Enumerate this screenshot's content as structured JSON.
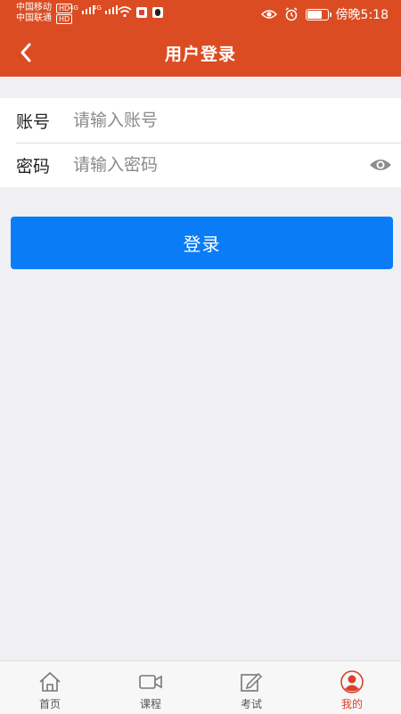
{
  "status_bar": {
    "carrier1": "中国移动",
    "carrier2": "中国联通",
    "hd_badge": "HD",
    "net1": "4G",
    "net2": "4G",
    "time": "傍晚5:18",
    "battery_level": 0.7
  },
  "header": {
    "title": "用户登录",
    "back_icon": "chevron-left-icon",
    "bg_color": "#dc4c22"
  },
  "form": {
    "account_label": "账号",
    "account_placeholder": "请输入账号",
    "account_value": "",
    "password_label": "密码",
    "password_placeholder": "请输入密码",
    "password_value": "",
    "toggle_icon": "eye-icon"
  },
  "login_button": {
    "label": "登录",
    "color": "#0a7cf5"
  },
  "tabbar": {
    "items": [
      {
        "label": "首页",
        "icon": "home-icon"
      },
      {
        "label": "课程",
        "icon": "video-camera-icon"
      },
      {
        "label": "考试",
        "icon": "edit-icon"
      },
      {
        "label": "我的",
        "icon": "user-icon",
        "active": true
      }
    ],
    "active_color": "#d9412a"
  }
}
